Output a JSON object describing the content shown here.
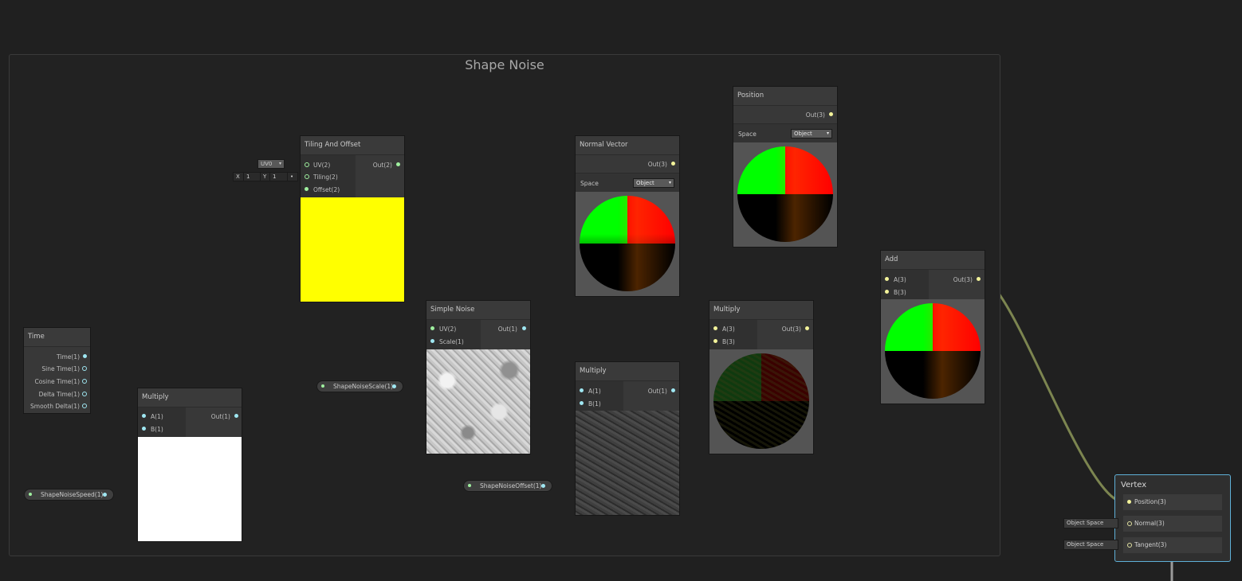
{
  "group": {
    "title": "Shape Noise"
  },
  "nodes": {
    "time": {
      "title": "Time",
      "outputs": [
        "Time(1)",
        "Sine Time(1)",
        "Cosine Time(1)",
        "Delta Time(1)",
        "Smooth Delta(1)"
      ]
    },
    "multiply1": {
      "title": "Multiply",
      "inputs": [
        "A(1)",
        "B(1)"
      ],
      "output": "Out(1)"
    },
    "tiling": {
      "title": "Tiling And Offset",
      "inputs": [
        "UV(2)",
        "Tiling(2)",
        "Offset(2)"
      ],
      "output": "Out(2)",
      "uv_select": "UV0",
      "tiling_x_label": "X",
      "tiling_x": "1",
      "tiling_y_label": "Y",
      "tiling_y": "1"
    },
    "simple_noise": {
      "title": "Simple Noise",
      "inputs": [
        "UV(2)",
        "Scale(1)"
      ],
      "output": "Out(1)"
    },
    "multiply2": {
      "title": "Multiply",
      "inputs": [
        "A(1)",
        "B(1)"
      ],
      "output": "Out(1)"
    },
    "normal_vector": {
      "title": "Normal Vector",
      "output": "Out(3)",
      "space_label": "Space",
      "space_value": "Object"
    },
    "position": {
      "title": "Position",
      "output": "Out(3)",
      "space_label": "Space",
      "space_value": "Object"
    },
    "multiply3": {
      "title": "Multiply",
      "inputs": [
        "A(3)",
        "B(3)"
      ],
      "output": "Out(3)"
    },
    "add": {
      "title": "Add",
      "inputs": [
        "A(3)",
        "B(3)"
      ],
      "output": "Out(3)"
    }
  },
  "properties": {
    "speed": "ShapeNoiseSpeed(1)",
    "scale": "ShapeNoiseScale(1)",
    "offset": "ShapeNoiseOffset(1)"
  },
  "vertex": {
    "title": "Vertex",
    "slots": [
      "Position(3)",
      "Normal(3)",
      "Tangent(3)"
    ],
    "normal_space": "Object Space",
    "tangent_space": "Object Space"
  },
  "colors": {
    "background": "#202020",
    "wire_float": "#5b8f96",
    "wire_vec3": "#7c8550",
    "wire_vec2": "#6fa36f",
    "vertex_border": "#5fb0d8",
    "preview_yellow": "#ffff00"
  }
}
